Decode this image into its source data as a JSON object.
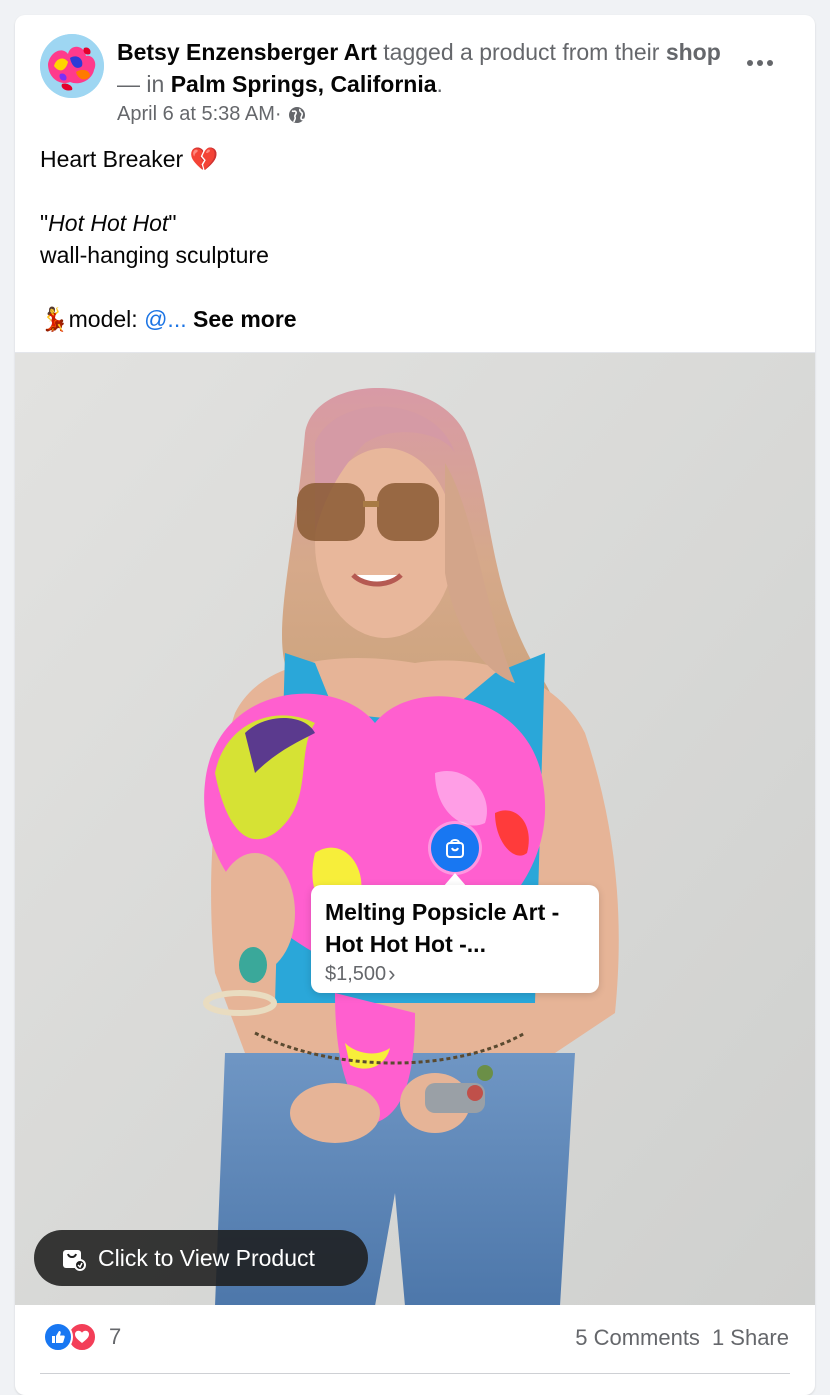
{
  "post": {
    "author": "Betsy Enzensberger Art",
    "action_text": " tagged a product from their ",
    "shop_link": "shop",
    "location_prefix": " — in ",
    "location": "Palm Springs, California",
    "location_suffix": ".",
    "timestamp": "April 6 at 5:38 AM",
    "meta_separator": " · ",
    "privacy_icon": "globe-icon",
    "more_icon": "more-options-icon"
  },
  "caption": {
    "line1": "Heart Breaker ",
    "line1_emoji": "💔",
    "quote_open": "\"",
    "quote_title": "Hot Hot Hot",
    "quote_close": "\"",
    "line3": "wall-hanging sculpture",
    "model_emoji": "💃",
    "model_label": "model: ",
    "mention": "@...",
    "see_more": " See more"
  },
  "product_tag": {
    "title": "Melting Popsicle Art - Hot Hot Hot -...",
    "price": "$1,500",
    "chevron": "›",
    "pin_icon": "shopping-bag-icon"
  },
  "view_product": {
    "label": "Click to View Product",
    "icon": "shop-bag-icon"
  },
  "footer": {
    "reaction_count": "7",
    "comments": "5 Comments",
    "shares": "1 Share"
  },
  "colors": {
    "accent": "#1877f2",
    "love": "#f33e58",
    "secondary_text": "#65676b",
    "background": "#f0f2f5"
  }
}
